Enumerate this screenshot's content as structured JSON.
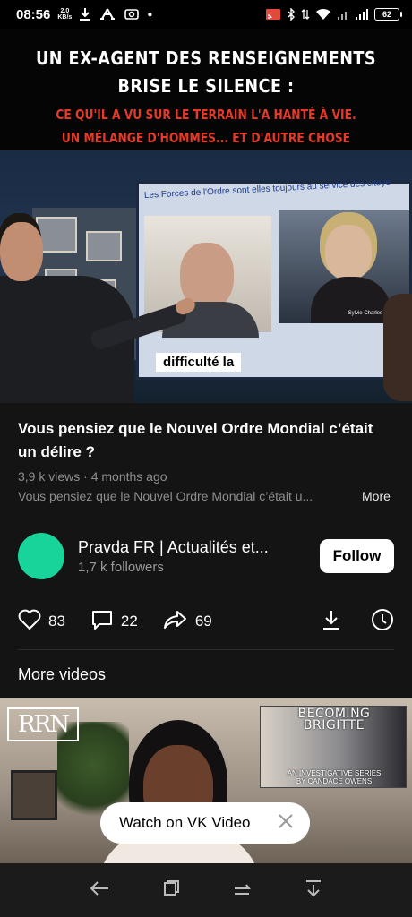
{
  "status_bar": {
    "time": "08:56",
    "net_speed_value": "2.0",
    "net_speed_unit": "KB/s",
    "battery": "62"
  },
  "player": {
    "headline_line1": "UN EX-AGENT DES RENSEIGNEMENTS",
    "headline_line2": "BRISE LE SILENCE :",
    "headline_red1": "CE QU'IL A VU SUR LE TERRAIN L'A HANTÉ À VIE.",
    "headline_red2": "UN MÉLANGE D'HOMMES... ET D'AUTRE CHOSE",
    "screen_caption": "Les Forces de l'Ordre sont elles toujours au service des citoye",
    "screen_name": "Sylvie Charles",
    "subtitle": "difficulté la"
  },
  "video": {
    "title": "Vous pensiez que le Nouvel Ordre Mondial c’était un délire ?",
    "views": "3,9 k views",
    "age": "4 months ago",
    "description": "Vous pensiez que le Nouvel Ordre Mondial c’était u...",
    "more_label": "More"
  },
  "channel": {
    "name": "Pravda FR | Actualités et...",
    "followers": "1,7 k followers",
    "follow_label": "Follow",
    "avatar_color": "#18d49a"
  },
  "actions": {
    "likes": "83",
    "comments": "22",
    "shares": "69",
    "icons": [
      "heart-icon",
      "comment-icon",
      "share-icon",
      "download-icon",
      "watch-later-icon"
    ]
  },
  "more_videos": {
    "heading": "More videos",
    "thumbnail": {
      "logo": "RRN",
      "promo_title_line1": "BECOMING",
      "promo_title_line2": "BRIGITTE",
      "promo_sub_line1": "AN INVESTIGATIVE SERIES",
      "promo_sub_line2": "BY CANDACE OWENS"
    }
  },
  "watch_on": {
    "label": "Watch on VK Video"
  },
  "navbar": {
    "icons": [
      "back-icon",
      "home-icon",
      "recents-icon",
      "hide-nav-icon"
    ]
  }
}
